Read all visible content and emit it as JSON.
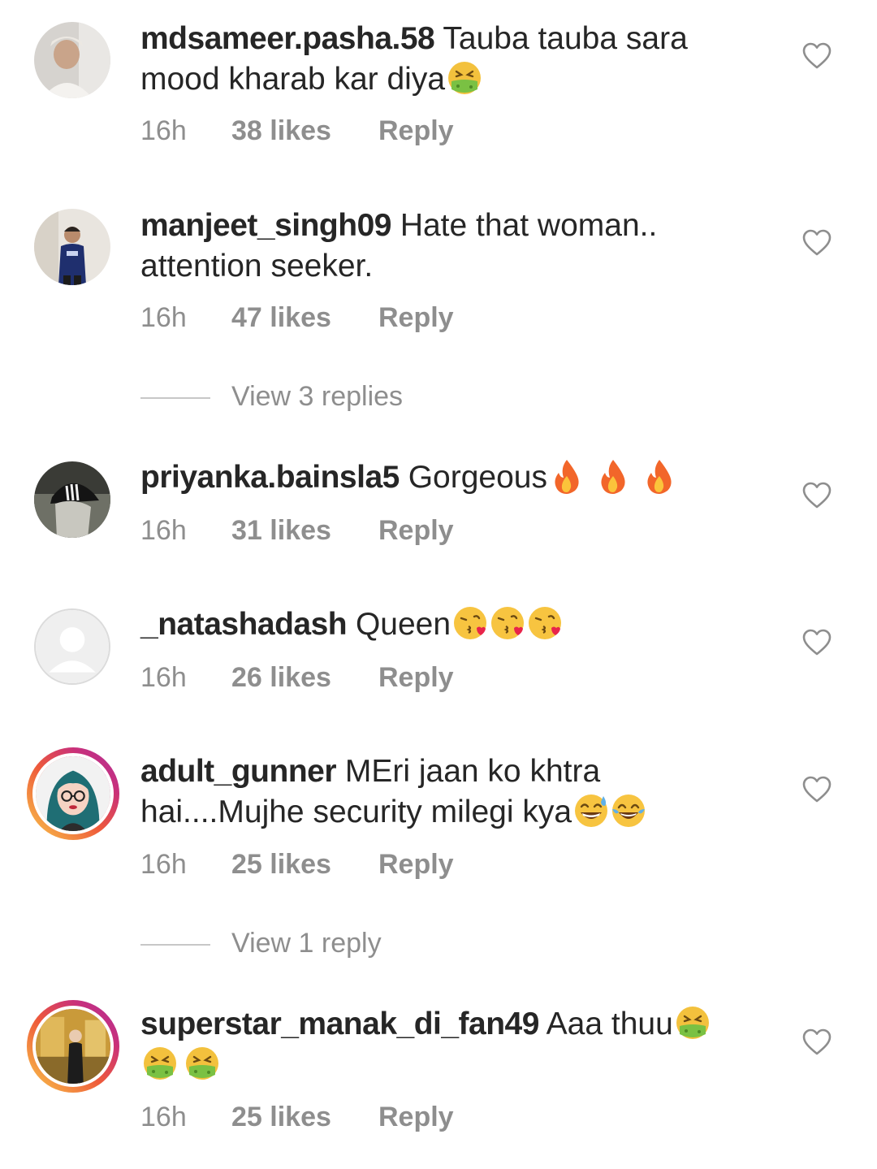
{
  "comments": [
    {
      "username": "mdsameer.pasha.58",
      "text": "Tauba tauba sara mood kharab kar diya",
      "emojis": [
        "nauseated-face"
      ],
      "time": "16h",
      "likes": "38 likes",
      "reply": "Reply",
      "avatar": "photo"
    },
    {
      "username": "manjeet_singh09",
      "text": "Hate that woman.. attention seeker.",
      "emojis": [],
      "time": "16h",
      "likes": "47 likes",
      "reply": "Reply",
      "avatar": "photo",
      "view_replies": "View 3 replies"
    },
    {
      "username": "priyanka.bainsla5",
      "text": "Gorgeous",
      "emojis": [
        "fire",
        "fire",
        "fire"
      ],
      "time": "16h",
      "likes": "31 likes",
      "reply": "Reply",
      "avatar": "photo"
    },
    {
      "username": "_natashadash",
      "text": "Queen",
      "emojis": [
        "face-blowing-kiss",
        "face-blowing-kiss",
        "face-blowing-kiss"
      ],
      "time": "16h",
      "likes": "26 likes",
      "reply": "Reply",
      "avatar": "default"
    },
    {
      "username": "adult_gunner",
      "text": "MEri jaan ko khtra hai....Mujhe security milegi kya",
      "emojis": [
        "grinning-sweat",
        "tears-of-joy"
      ],
      "time": "16h",
      "likes": "25 likes",
      "reply": "Reply",
      "avatar": "illustration-story",
      "view_replies": "View 1 reply"
    },
    {
      "username": "superstar_manak_di_fan49",
      "text": "Aaa thuu",
      "emojis": [
        "nauseated-face",
        "nauseated-face",
        "nauseated-face"
      ],
      "time": "16h",
      "likes": "25 likes",
      "reply": "Reply",
      "avatar": "photo-story"
    }
  ],
  "icons": {
    "like": "heart-outline-icon"
  },
  "colors": {
    "text": "#262626",
    "secondary": "#8e8e8e",
    "divider": "#c7c7c7",
    "story_ring": "#e1306c"
  }
}
